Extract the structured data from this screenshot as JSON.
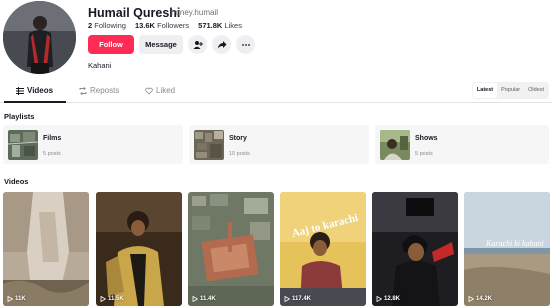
{
  "profile": {
    "name": "Humail Qureshi",
    "username": "honey.humail",
    "following_count": "2",
    "following_label": "Following",
    "followers_count": "13.6K",
    "followers_label": "Followers",
    "likes_count": "571.8K",
    "likes_label": "Likes",
    "bio": "Kahani"
  },
  "actions": {
    "follow_label": "Follow",
    "message_label": "Message"
  },
  "tabs": {
    "videos": "Videos",
    "reposts": "Reposts",
    "liked": "Liked"
  },
  "sort": {
    "latest": "Latest",
    "popular": "Popular",
    "oldest": "Oldest"
  },
  "playlists": {
    "title": "Playlists",
    "items": [
      {
        "title": "Films",
        "count": "5 posts"
      },
      {
        "title": "Story",
        "count": "10 posts"
      },
      {
        "title": "Shows",
        "count": "5 posts"
      }
    ]
  },
  "videos": {
    "title": "Videos",
    "items": [
      {
        "views": "11K",
        "overlay": ""
      },
      {
        "views": "11.5K",
        "overlay": ""
      },
      {
        "views": "11.4K",
        "overlay": ""
      },
      {
        "views": "117.4K",
        "overlay": "Aaj to karachi"
      },
      {
        "views": "12.8K",
        "overlay": ""
      },
      {
        "views": "14.2K",
        "overlay": "Karachi ki kahani"
      }
    ]
  },
  "colors": {
    "accent": "#fe2c55",
    "text_primary": "#161823",
    "text_secondary": "#8a8b91"
  }
}
